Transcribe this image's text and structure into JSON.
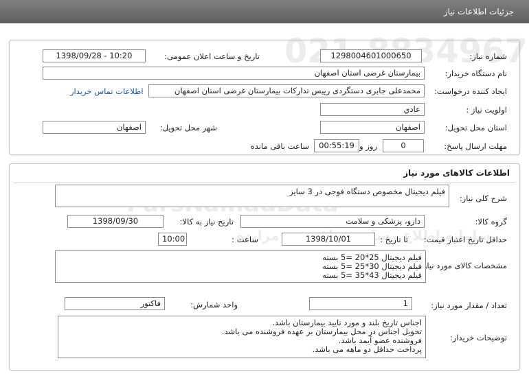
{
  "header": {
    "title": "جزئیات اطلاعات نیاز"
  },
  "info": {
    "need_number_label": "شماره نیاز:",
    "need_number": "1298004601000650",
    "announce_datetime_label": "تاریخ و ساعت اعلان عمومی:",
    "announce_datetime": "1398/09/28 - 10:20",
    "buyer_org_label": "نام دستگاه خریدار:",
    "buyer_org": "بیمارستان غرضی استان اصفهان",
    "creator_label": "ایجاد کننده درخواست:",
    "creator": "محمدعلی جابری دستگردی رییس تدارکات بیمارستان غرضی استان اصفهان",
    "contact_link": "اطلاعات تماس خریدار",
    "priority_label": "اولویت نیاز :",
    "priority": "عادي",
    "delivery_province_label": "استان محل تحویل:",
    "delivery_province": "اصفهان",
    "delivery_city_label": "شهر محل تحویل:",
    "delivery_city": "اصفهان",
    "deadline_label": "مهلت ارسال پاسخ:",
    "deadline_days": "0",
    "days_label": "روز و",
    "deadline_time": "00:55:19",
    "remaining_label": "ساعت باقی مانده"
  },
  "goods": {
    "section_title": "اطلاعات کالاهای مورد نیاز",
    "summary_label": "شرح کلی نیاز:",
    "summary": "فیلم دیجیتال مخصوص دستگاه فوجی در 3 سایز",
    "group_label": "گروه کالا:",
    "group": "دارو، پزشکی و سلامت",
    "need_date_label": "تاریخ نیاز به کالا:",
    "need_date": "1398/09/30",
    "validity_label": "حداقل تاریخ اعتبار قیمت:",
    "until_date_label": "تا تاریخ :",
    "validity_date": "1398/10/01",
    "hour_label": "ساعت :",
    "validity_time": "10:00",
    "specs_label": "مشخصات کالای مورد نیاز:",
    "specs": [
      "فیلم دیجیتال 25*20 =5 بسته",
      "فیلم دیجیتال 30*25 =5 بسته",
      "فیلم دیجیتال 43*35 =5 بسته"
    ],
    "quantity_label": "تعداد / مقدار مورد نیاز:",
    "quantity": "1",
    "unit_label": "واحد شمارش:",
    "unit": "فاکتور",
    "notes_label": "توضیحات خریدار:",
    "notes": [
      "اجناس تاریخ بلند و مورد تایید بیمارستان باشد.",
      "تحویل اجناس در محل بیمارستان بر عهده فروشنده می باشد.",
      "فروشنده عضو آیمد باشد.",
      "پرداخت حداقل دو ماهه می باشد."
    ]
  },
  "watermark": {
    "brand": "ParsNamadData",
    "phone": "021-88349670-5",
    "slogan": "سامانه اطلاع رسانی مناقصه و مزایده"
  }
}
